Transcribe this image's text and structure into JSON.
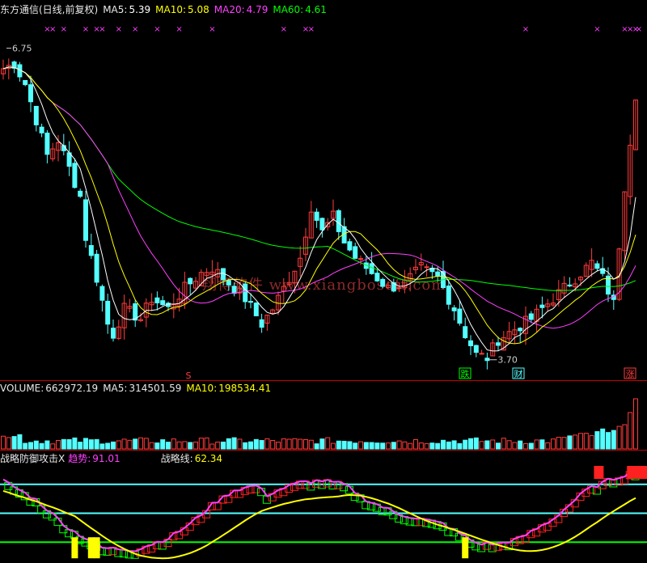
{
  "header": {
    "name": "东方通信(日线,前复权)",
    "ma5_label": "MA5:",
    "ma5": "5.39",
    "ma10_label": "MA10:",
    "ma10": "5.08",
    "ma20_label": "MA20:",
    "ma20": "4.79",
    "ma60_label": "MA60:",
    "ma60": "4.61"
  },
  "price_panel": {
    "high_marker": "6.75",
    "low_marker": "3.70",
    "watermark": "翔博软件 www.xiangbosoft.com",
    "tag_die": "跌",
    "tag_cai": "财",
    "tag_zhang": "涨",
    "tag_s": "S",
    "x_mark": "×"
  },
  "volume_header": {
    "vol_label": "VOLUME:",
    "vol": "662972.19",
    "ma5_label": "MA5:",
    "ma5": "314501.59",
    "ma10_label": "MA10:",
    "ma10": "198534.41"
  },
  "indicator_header": {
    "name": "战略防御攻击X",
    "trend_label": "趋势:",
    "trend": "91.01",
    "strategy_label": "战略线:",
    "strategy": "62.34"
  },
  "colors": {
    "bg": "#000000",
    "up": "#ff3c3c",
    "down": "#54ffff",
    "ma5": "#ffffff",
    "ma10": "#ffff00",
    "ma20": "#ff40ff",
    "ma60": "#00ff00",
    "grid": "#8b0000",
    "divider": "#c80000",
    "green_box": "#00ff00",
    "red_box": "#ff2020",
    "yellow": "#ffff00"
  },
  "chart_data": [
    {
      "type": "candlestick",
      "title": "东方通信(日线,前复权)",
      "ylim": [
        3.5,
        7.0
      ],
      "bars": 116,
      "pivots_close": [
        [
          0,
          6.55
        ],
        [
          2,
          6.6
        ],
        [
          4,
          6.4
        ],
        [
          8,
          5.7
        ],
        [
          10,
          5.85
        ],
        [
          14,
          5.3
        ],
        [
          15,
          4.9
        ],
        [
          17,
          4.5
        ],
        [
          19,
          4.05
        ],
        [
          20,
          3.95
        ],
        [
          22,
          4.2
        ],
        [
          25,
          4.1
        ],
        [
          27,
          4.3
        ],
        [
          30,
          4.2
        ],
        [
          33,
          4.4
        ],
        [
          36,
          4.55
        ],
        [
          38,
          4.6
        ],
        [
          40,
          4.5
        ],
        [
          44,
          4.3
        ],
        [
          47,
          4.05
        ],
        [
          49,
          4.2
        ],
        [
          52,
          4.5
        ],
        [
          54,
          4.7
        ],
        [
          56,
          5.2
        ],
        [
          58,
          4.95
        ],
        [
          60,
          5.1
        ],
        [
          62,
          4.85
        ],
        [
          64,
          4.7
        ],
        [
          67,
          4.55
        ],
        [
          70,
          4.4
        ],
        [
          73,
          4.45
        ],
        [
          76,
          4.6
        ],
        [
          79,
          4.5
        ],
        [
          82,
          4.2
        ],
        [
          84,
          3.95
        ],
        [
          86,
          3.75
        ],
        [
          88,
          3.72
        ],
        [
          90,
          3.9
        ],
        [
          93,
          4.0
        ],
        [
          96,
          4.1
        ],
        [
          100,
          4.3
        ],
        [
          104,
          4.5
        ],
        [
          107,
          4.65
        ],
        [
          109,
          4.5
        ],
        [
          111,
          4.25
        ],
        [
          113,
          5.4
        ],
        [
          115,
          6.3
        ]
      ],
      "high_marker": 6.75,
      "low_marker": 3.7,
      "ma_last": {
        "MA5": 5.39,
        "MA10": 5.08,
        "MA20": 4.79,
        "MA60": 4.61
      }
    },
    {
      "type": "bar",
      "title": "VOLUME",
      "values_last": {
        "VOLUME": 662972.19,
        "MA5": 314501.59,
        "MA10": 198534.41
      }
    },
    {
      "type": "line",
      "title": "战略防御攻击X",
      "values_last": {
        "趋势": 91.01,
        "战略线": 62.34
      }
    }
  ]
}
